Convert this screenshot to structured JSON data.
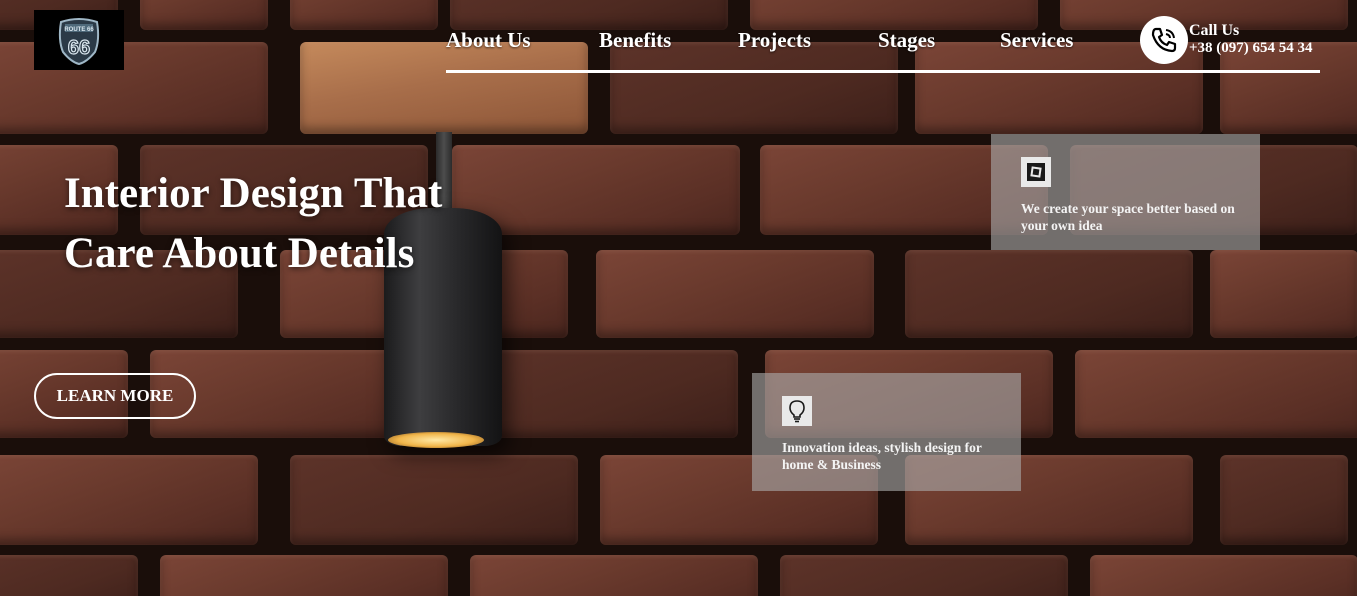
{
  "brand": {
    "logo_icon": "route-66-shield-icon",
    "logo_text": "ROUTE 66"
  },
  "nav": {
    "items": [
      {
        "label": "About Us"
      },
      {
        "label": "Benefits"
      },
      {
        "label": "Projects"
      },
      {
        "label": "Stages"
      },
      {
        "label": "Services"
      }
    ]
  },
  "contact": {
    "icon": "phone-icon",
    "title": "Call Us",
    "phone": "+38 (097) 654 54 34"
  },
  "hero": {
    "headline_line1": "Interior Design That",
    "headline_line2": "Care About Details",
    "cta_label": "LEARN MORE"
  },
  "features": [
    {
      "icon": "square-frame-icon",
      "text": "We create your space better based on your own idea"
    },
    {
      "icon": "lightbulb-icon",
      "text": "Innovation ideas, stylish design for home & Business"
    }
  ],
  "colors": {
    "text": "#ffffff",
    "card_bg": "rgba(170,170,170,0.62)",
    "logo_bg": "#000000"
  }
}
